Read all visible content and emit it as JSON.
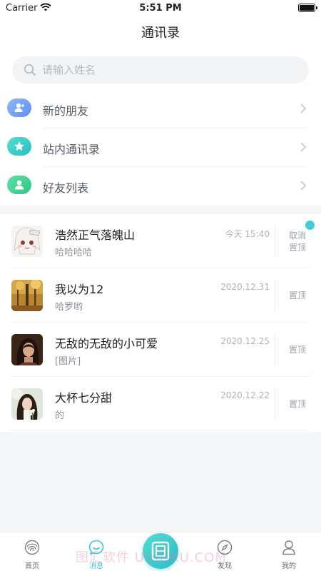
{
  "status_bar": {
    "carrier": "Carrier",
    "time": "5:51 PM"
  },
  "header": {
    "title": "通讯录"
  },
  "search": {
    "placeholder": "请输入姓名"
  },
  "menu": {
    "items": [
      {
        "label": "新的朋友",
        "icon": "new-friends-icon",
        "color": "#6fa5f5"
      },
      {
        "label": "站内通讯录",
        "icon": "star-icon",
        "color": "#35cfc8"
      },
      {
        "label": "好友列表",
        "icon": "friends-list-icon",
        "color": "#3fd08e"
      }
    ]
  },
  "chats": [
    {
      "name": "浩然正气落魄山",
      "preview": "哈哈哈哈",
      "time": "今天 15:40",
      "action": "取消置顶",
      "action_line1": "取消",
      "action_line2": "置顶",
      "unread": true
    },
    {
      "name": "我以为12",
      "preview": "哈罗哟",
      "time": "2020.12.31",
      "action": "置顶"
    },
    {
      "name": "无敌的无敌的小可爱",
      "preview": "[图片]",
      "time": "2020.12.25",
      "action": "置顶"
    },
    {
      "name": "大杯七分甜",
      "preview": "的",
      "time": "2020.12.22",
      "action": "置顶"
    }
  ],
  "tabbar": {
    "tabs": [
      {
        "label": "首页",
        "icon": "fingerprint-icon"
      },
      {
        "label": "消息",
        "icon": "message-icon",
        "active": true
      },
      {
        "label": "发现",
        "icon": "compass-icon"
      },
      {
        "label": "我的",
        "icon": "profile-icon"
      }
    ],
    "center_icon": "contacts-book-icon"
  },
  "colors": {
    "accent": "#3cc7cc",
    "unread": "#3fcfd5"
  },
  "watermark": "图汇软件 UIHHRU.COM"
}
